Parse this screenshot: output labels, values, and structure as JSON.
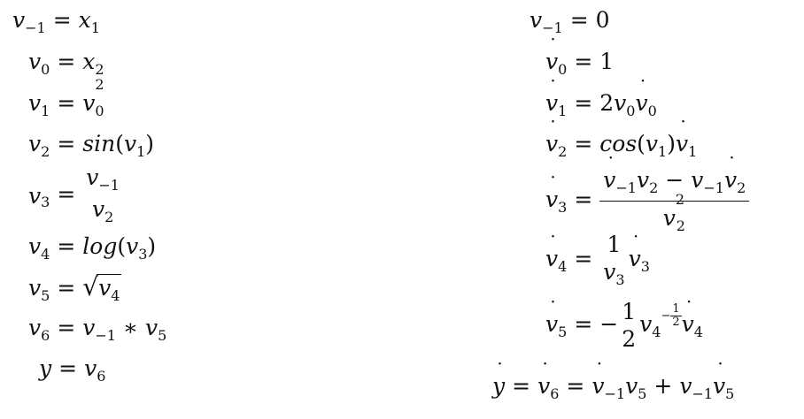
{
  "left": {
    "r0": {
      "lhs": "v",
      "lhs_sub": "−1",
      "rhs": "x",
      "rhs_sub": "1"
    },
    "r1": {
      "lhs": "v",
      "lhs_sub": "0",
      "rhs": "x",
      "rhs_sub": "2"
    },
    "r2": {
      "lhs": "v",
      "lhs_sub": "1",
      "rhs": "v",
      "rhs_sub": "0",
      "rhs_sup": "2"
    },
    "r3": {
      "lhs": "v",
      "lhs_sub": "2",
      "fn": "sin",
      "arg": "v",
      "arg_sub": "1"
    },
    "r4": {
      "lhs": "v",
      "lhs_sub": "3",
      "num": "v",
      "num_sub": "−1",
      "den": "v",
      "den_sub": "2"
    },
    "r5": {
      "lhs": "v",
      "lhs_sub": "4",
      "fn": "log",
      "arg": "v",
      "arg_sub": "3"
    },
    "r6": {
      "lhs": "v",
      "lhs_sub": "5",
      "rad": "v",
      "rad_sub": "4"
    },
    "r7": {
      "lhs": "v",
      "lhs_sub": "6",
      "a": "v",
      "a_sub": "−1",
      "mul": "∗",
      "b": "v",
      "b_sub": "5"
    },
    "r8": {
      "lhs": "y",
      "rhs": "v",
      "rhs_sub": "6"
    }
  },
  "right": {
    "r0": {
      "lhs": "v",
      "lhs_sub": "−1",
      "rhs": "0"
    },
    "r1": {
      "lhs": "v",
      "lhs_sub": "0",
      "rhs": "1"
    },
    "r2": {
      "lhs": "v",
      "lhs_sub": "1",
      "coef": "2",
      "a": "v",
      "a_sub": "0",
      "b": "v",
      "b_sub": "0"
    },
    "r3": {
      "lhs": "v",
      "lhs_sub": "2",
      "fn": "cos",
      "arg": "v",
      "arg_sub": "1",
      "b": "v",
      "b_sub": "1"
    },
    "r4": {
      "lhs": "v",
      "lhs_sub": "3",
      "n1": "v",
      "n1_sub": "−1",
      "n2": "v",
      "n2_sub": "2",
      "minus": "−",
      "n3": "v",
      "n3_sub": "−1",
      "n4": "v",
      "n4_sub": "2",
      "den": "v",
      "den_sub": "2",
      "den_sup": "2"
    },
    "r5": {
      "lhs": "v",
      "lhs_sub": "4",
      "num": "1",
      "den": "v",
      "den_sub": "3",
      "b": "v",
      "b_sub": "3"
    },
    "r6": {
      "lhs": "v",
      "lhs_sub": "5",
      "neg": "−",
      "num": "1",
      "den": "2",
      "a": "v",
      "a_sub": "4",
      "exp_neg": "−",
      "exp_num": "1",
      "exp_den": "2",
      "b": "v",
      "b_sub": "4"
    },
    "r7": {
      "lhs": "y",
      "mid": "v",
      "mid_sub": "6",
      "a": "v",
      "a_sub": "−1",
      "a2": "v",
      "a2_sub": "5",
      "plus": "+",
      "b": "v",
      "b_sub": "−1",
      "b2": "v",
      "b2_sub": "5"
    }
  },
  "eq_sign": "="
}
